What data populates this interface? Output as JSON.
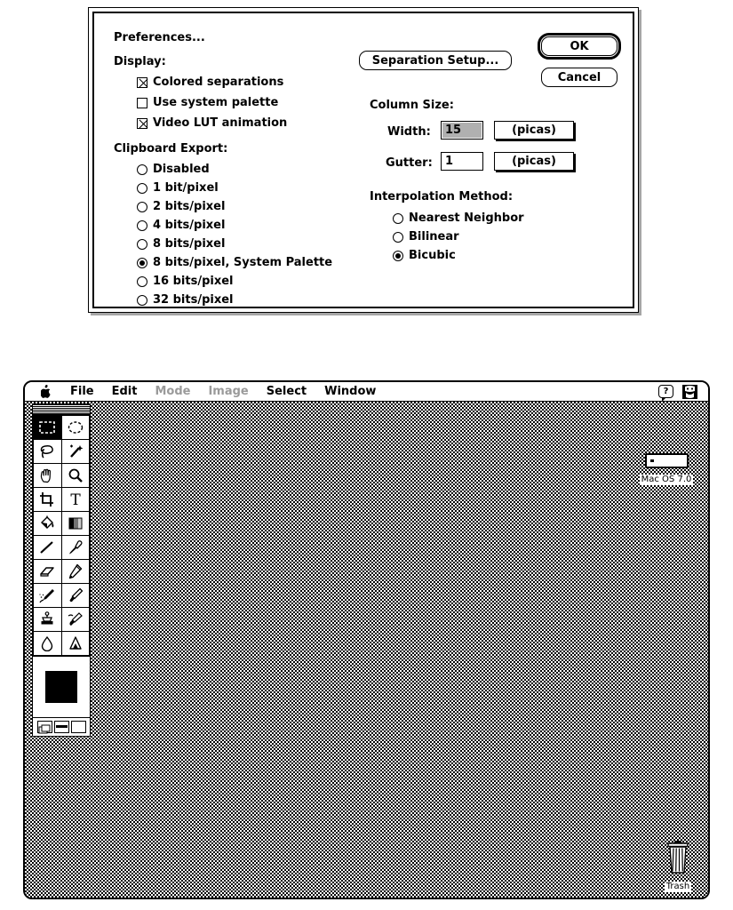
{
  "dialog": {
    "title": "Preferences...",
    "display": {
      "heading": "Display:",
      "checkboxes": [
        {
          "label": "Colored separations",
          "checked": true
        },
        {
          "label": "Use system palette",
          "checked": false
        },
        {
          "label": "Video LUT animation",
          "checked": true
        }
      ]
    },
    "clipboard_export": {
      "heading": "Clipboard Export:",
      "options": [
        "Disabled",
        "1 bit/pixel",
        "2 bits/pixel",
        "4 bits/pixel",
        "8 bits/pixel",
        "8 bits/pixel, System Palette",
        "16 bits/pixel",
        "32 bits/pixel"
      ],
      "selected": "8 bits/pixel, System Palette"
    },
    "separation_setup_label": "Separation Setup...",
    "ok_label": "OK",
    "cancel_label": "Cancel",
    "column_size": {
      "heading": "Column Size:",
      "width_label": "Width:",
      "width_value": "15",
      "width_units": "(picas)",
      "gutter_label": "Gutter:",
      "gutter_value": "1",
      "gutter_units": "(picas)"
    },
    "interpolation": {
      "heading": "Interpolation Method:",
      "options": [
        "Nearest Neighbor",
        "Bilinear",
        "Bicubic"
      ],
      "selected": "Bicubic"
    }
  },
  "desktop": {
    "menubar": {
      "apple_icon": "apple-icon",
      "items": [
        {
          "label": "File",
          "enabled": true
        },
        {
          "label": "Edit",
          "enabled": true
        },
        {
          "label": "Mode",
          "enabled": false
        },
        {
          "label": "Image",
          "enabled": false
        },
        {
          "label": "Select",
          "enabled": true
        },
        {
          "label": "Window",
          "enabled": true
        }
      ],
      "help_icon": "?",
      "app_switcher_icon": "finder-face-icon"
    },
    "toolbox": {
      "tools": [
        {
          "name": "rectangular-marquee-tool",
          "active": true
        },
        {
          "name": "elliptical-marquee-tool",
          "active": false
        },
        {
          "name": "lasso-tool",
          "active": false
        },
        {
          "name": "magic-wand-tool",
          "active": false
        },
        {
          "name": "hand-tool",
          "active": false
        },
        {
          "name": "zoom-tool",
          "active": false
        },
        {
          "name": "crop-tool",
          "active": false
        },
        {
          "name": "type-tool",
          "active": false
        },
        {
          "name": "paint-bucket-tool",
          "active": false
        },
        {
          "name": "gradient-tool",
          "active": false
        },
        {
          "name": "line-tool",
          "active": false
        },
        {
          "name": "eyedropper-tool",
          "active": false
        },
        {
          "name": "eraser-tool",
          "active": false
        },
        {
          "name": "pencil-tool",
          "active": false
        },
        {
          "name": "airbrush-tool",
          "active": false
        },
        {
          "name": "paintbrush-tool",
          "active": false
        },
        {
          "name": "rubber-stamp-tool",
          "active": false
        },
        {
          "name": "smudge-tool",
          "active": false
        },
        {
          "name": "blur-tool",
          "active": false
        },
        {
          "name": "sharpen-tool",
          "active": false
        }
      ],
      "foreground_color": "#000000",
      "screen_modes": [
        "standard-screen-mode",
        "full-screen-menubar-mode",
        "full-screen-mode"
      ],
      "screen_mode_selected": "standard-screen-mode"
    },
    "icons": {
      "hard_disk_label": "Mac OS 7.0",
      "trash_label": "Trash"
    }
  }
}
